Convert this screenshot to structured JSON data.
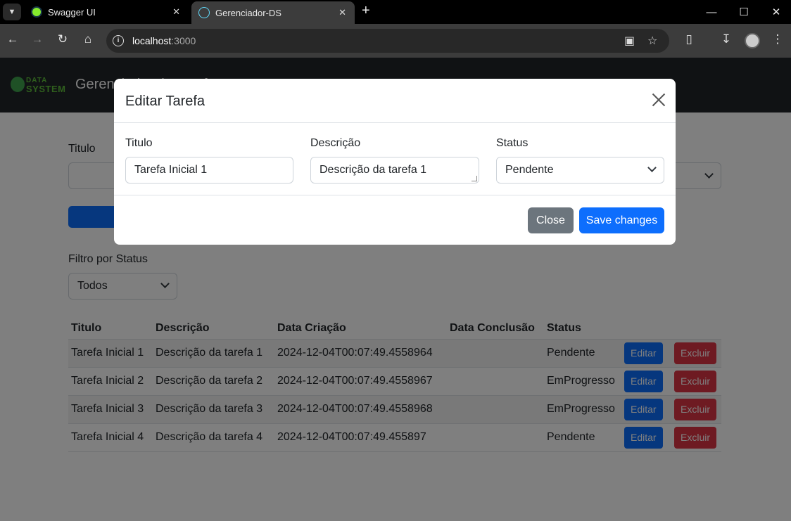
{
  "browser": {
    "tabs": [
      {
        "title": "Swagger UI"
      },
      {
        "title": "Gerenciador-DS"
      }
    ],
    "url_host": "localhost",
    "url_port": ":3000"
  },
  "app": {
    "brand": "Gerenciador de Tarefas",
    "logo_line1": "DATA",
    "logo_line2": "SYSTEM"
  },
  "form": {
    "titulo_label": "Titulo",
    "filter_label": "Filtro por Status",
    "filter_value": "Todos"
  },
  "table": {
    "headers": [
      "Titulo",
      "Descrição",
      "Data Criação",
      "Data Conclusão",
      "Status"
    ],
    "rows": [
      {
        "titulo": "Tarefa Inicial 1",
        "descricao": "Descrição da tarefa 1",
        "criacao": "2024-12-04T00:07:49.4558964",
        "conclusao": "",
        "status": "Pendente"
      },
      {
        "titulo": "Tarefa Inicial 2",
        "descricao": "Descrição da tarefa 2",
        "criacao": "2024-12-04T00:07:49.4558967",
        "conclusao": "",
        "status": "EmProgresso"
      },
      {
        "titulo": "Tarefa Inicial 3",
        "descricao": "Descrição da tarefa 3",
        "criacao": "2024-12-04T00:07:49.4558968",
        "conclusao": "",
        "status": "EmProgresso"
      },
      {
        "titulo": "Tarefa Inicial 4",
        "descricao": "Descrição da tarefa 4",
        "criacao": "2024-12-04T00:07:49.455897",
        "conclusao": "",
        "status": "Pendente"
      }
    ],
    "edit_label": "Editar",
    "delete_label": "Excluir"
  },
  "modal": {
    "title": "Editar Tarefa",
    "titulo_label": "Titulo",
    "titulo_value": "Tarefa Inicial 1",
    "descricao_label": "Descrição",
    "descricao_value": "Descrição da tarefa 1",
    "status_label": "Status",
    "status_value": "Pendente",
    "close_label": "Close",
    "save_label": "Save changes"
  },
  "colors": {
    "primary": "#0d6efd",
    "secondary": "#6c757d",
    "danger": "#dc3545",
    "navbar": "#212529"
  }
}
